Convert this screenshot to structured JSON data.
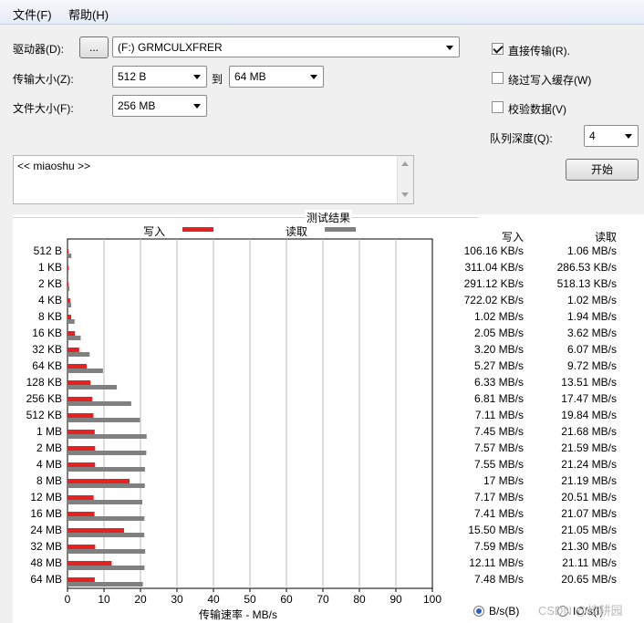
{
  "menu": {
    "file": "文件(F)",
    "help": "帮助(H)"
  },
  "controls": {
    "drive_label": "驱动器(D):",
    "browse_button": "...",
    "drive_value": "(F:) GRMCULXFRER",
    "transfer_size_label": "传输大小(Z):",
    "transfer_from": "512 B",
    "to_label": "到",
    "transfer_to": "64 MB",
    "file_size_label": "文件大小(F):",
    "file_size": "256 MB",
    "direct_io_label": "直接传输(R).",
    "direct_io_checked": true,
    "bypass_cache_label": "绕过写入缓存(W)",
    "bypass_cache_checked": false,
    "verify_label": "校验数据(V)",
    "verify_checked": false,
    "queue_depth_label": "队列深度(Q):",
    "queue_depth": "4",
    "start_button": "开始",
    "description": "<< miaoshu >>"
  },
  "results": {
    "title": "测试结果",
    "legend_write": "写入",
    "legend_read": "读取",
    "col_write": "写入",
    "col_read": "读取",
    "xlabel": "传输速率 - MB/s",
    "unit_bps": "B/s(B)",
    "unit_iops": "IO/s(I)",
    "unit_selected": "B/s",
    "watermark": "CSDN @校耕园"
  },
  "colors": {
    "write": "#e32222",
    "read": "#808080",
    "accent": "#2a63c8"
  },
  "chart_data": {
    "type": "bar",
    "orientation": "horizontal",
    "title": "测试结果",
    "xlabel": "传输速率 - MB/s",
    "xlim": [
      0,
      100
    ],
    "xticks": [
      "0",
      "10",
      "20",
      "30",
      "40",
      "50",
      "60",
      "70",
      "80",
      "90",
      "100"
    ],
    "grid": true,
    "legend_placement": "top",
    "categories": [
      "512 B",
      "1 KB",
      "2 KB",
      "4 KB",
      "8 KB",
      "16 KB",
      "32 KB",
      "64 KB",
      "128 KB",
      "256 KB",
      "512 KB",
      "1 MB",
      "2 MB",
      "4 MB",
      "8 MB",
      "12 MB",
      "16 MB",
      "24 MB",
      "32 MB",
      "48 MB",
      "64 MB"
    ],
    "series": [
      {
        "name": "写入",
        "values": [
          0.10616,
          0.31104,
          0.29112,
          0.72202,
          1.02,
          2.05,
          3.2,
          5.27,
          6.33,
          6.81,
          7.11,
          7.45,
          7.57,
          7.55,
          17,
          7.17,
          7.41,
          15.5,
          7.59,
          12.11,
          7.48
        ],
        "labels": [
          "106.16 KB/s",
          "311.04 KB/s",
          "291.12 KB/s",
          "722.02 KB/s",
          "1.02 MB/s",
          "2.05 MB/s",
          "3.20 MB/s",
          "5.27 MB/s",
          "6.33 MB/s",
          "6.81 MB/s",
          "7.11 MB/s",
          "7.45 MB/s",
          "7.57 MB/s",
          "7.55 MB/s",
          "17 MB/s",
          "7.17 MB/s",
          "7.41 MB/s",
          "15.50 MB/s",
          "7.59 MB/s",
          "12.11 MB/s",
          "7.48 MB/s"
        ]
      },
      {
        "name": "读取",
        "values": [
          1.06,
          0.28653,
          0.51813,
          1.02,
          1.94,
          3.62,
          6.07,
          9.72,
          13.51,
          17.47,
          19.84,
          21.68,
          21.59,
          21.24,
          21.19,
          20.51,
          21.07,
          21.05,
          21.3,
          21.11,
          20.65
        ],
        "labels": [
          "1.06 MB/s",
          "286.53 KB/s",
          "518.13 KB/s",
          "1.02 MB/s",
          "1.94 MB/s",
          "3.62 MB/s",
          "6.07 MB/s",
          "9.72 MB/s",
          "13.51 MB/s",
          "17.47 MB/s",
          "19.84 MB/s",
          "21.68 MB/s",
          "21.59 MB/s",
          "21.24 MB/s",
          "21.19 MB/s",
          "20.51 MB/s",
          "21.07 MB/s",
          "21.05 MB/s",
          "21.30 MB/s",
          "21.11 MB/s",
          "20.65 MB/s"
        ]
      }
    ]
  }
}
